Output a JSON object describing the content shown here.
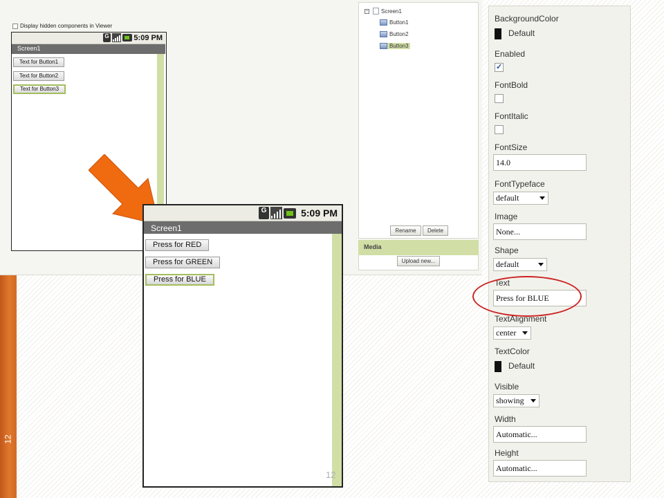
{
  "slide": {
    "page_number": "12"
  },
  "designer": {
    "hidden_components_label": "Display hidden components in Viewer"
  },
  "small_phone": {
    "time": "5:09 PM",
    "screen_title": "Screen1",
    "buttons": [
      "Text for Button1",
      "Text for Button2",
      "Text for Button3"
    ]
  },
  "big_phone": {
    "time": "5:09 PM",
    "screen_title": "Screen1",
    "buttons": [
      "Press for RED",
      "Press for GREEN",
      "Press for BLUE"
    ]
  },
  "status_icons": {
    "network": "G",
    "network_sub": "3G"
  },
  "components": {
    "tree": [
      {
        "label": "Screen1",
        "icon": "screen-icon"
      },
      {
        "label": "Button1",
        "icon": "button-icon"
      },
      {
        "label": "Button2",
        "icon": "button-icon"
      },
      {
        "label": "Button3",
        "icon": "button-icon",
        "selected": true
      }
    ],
    "rename_label": "Rename",
    "delete_label": "Delete",
    "media_title": "Media",
    "upload_label": "Upload new..."
  },
  "properties": {
    "background_color": {
      "label": "BackgroundColor",
      "value": "Default",
      "color": "#111111"
    },
    "enabled": {
      "label": "Enabled",
      "checked": true
    },
    "font_bold": {
      "label": "FontBold",
      "checked": false
    },
    "font_italic": {
      "label": "FontItalic",
      "checked": false
    },
    "font_size": {
      "label": "FontSize",
      "value": "14.0"
    },
    "font_typeface": {
      "label": "FontTypeface",
      "value": "default"
    },
    "image": {
      "label": "Image",
      "value": "None..."
    },
    "shape": {
      "label": "Shape",
      "value": "default"
    },
    "text": {
      "label": "Text",
      "value": "Press for BLUE"
    },
    "text_alignment": {
      "label": "TextAlignment",
      "value": "center"
    },
    "text_color": {
      "label": "TextColor",
      "value": "Default",
      "color": "#111111"
    },
    "visible": {
      "label": "Visible",
      "value": "showing"
    },
    "width": {
      "label": "Width",
      "value": "Automatic..."
    },
    "height": {
      "label": "Height",
      "value": "Automatic..."
    }
  },
  "colors": {
    "accent_green": "#d1dea6",
    "selected_border": "#a4bd5d",
    "arrow_orange": "#f06a10",
    "highlight_red": "#cc2222"
  }
}
